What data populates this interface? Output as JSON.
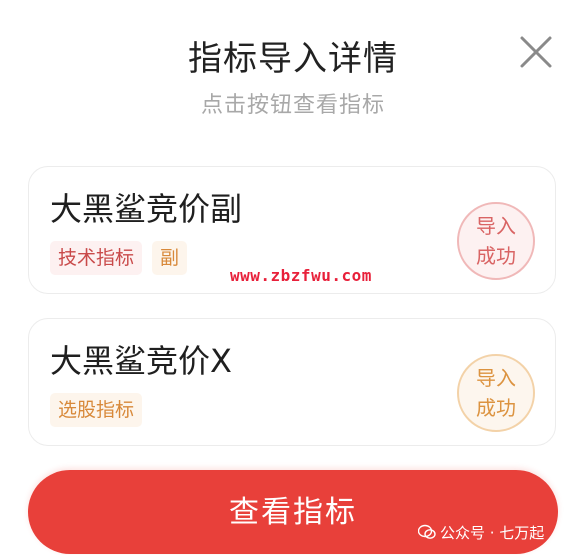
{
  "header": {
    "title": "指标导入详情",
    "subtitle": "点击按钮查看指标",
    "close_icon": "close-icon"
  },
  "indicators": [
    {
      "name": "大黑鲨竞价副",
      "tags": [
        "技术指标",
        "副"
      ],
      "status_line1": "导入",
      "status_line2": "成功",
      "accent": "#d96464"
    },
    {
      "name": "大黑鲨竞价X",
      "tags": [
        "选股指标"
      ],
      "status_line1": "导入",
      "status_line2": "成功",
      "accent": "#dc9340"
    }
  ],
  "watermark": "www.zbzfwu.com",
  "footer": {
    "button_label": "查看指标",
    "account_mark": "公众号 · 七万起"
  },
  "colors": {
    "primary_red": "#e8403a",
    "tag_red_text": "#c94a4a",
    "tag_orange_text": "#d8893a",
    "watermark_red": "#e8203a"
  }
}
